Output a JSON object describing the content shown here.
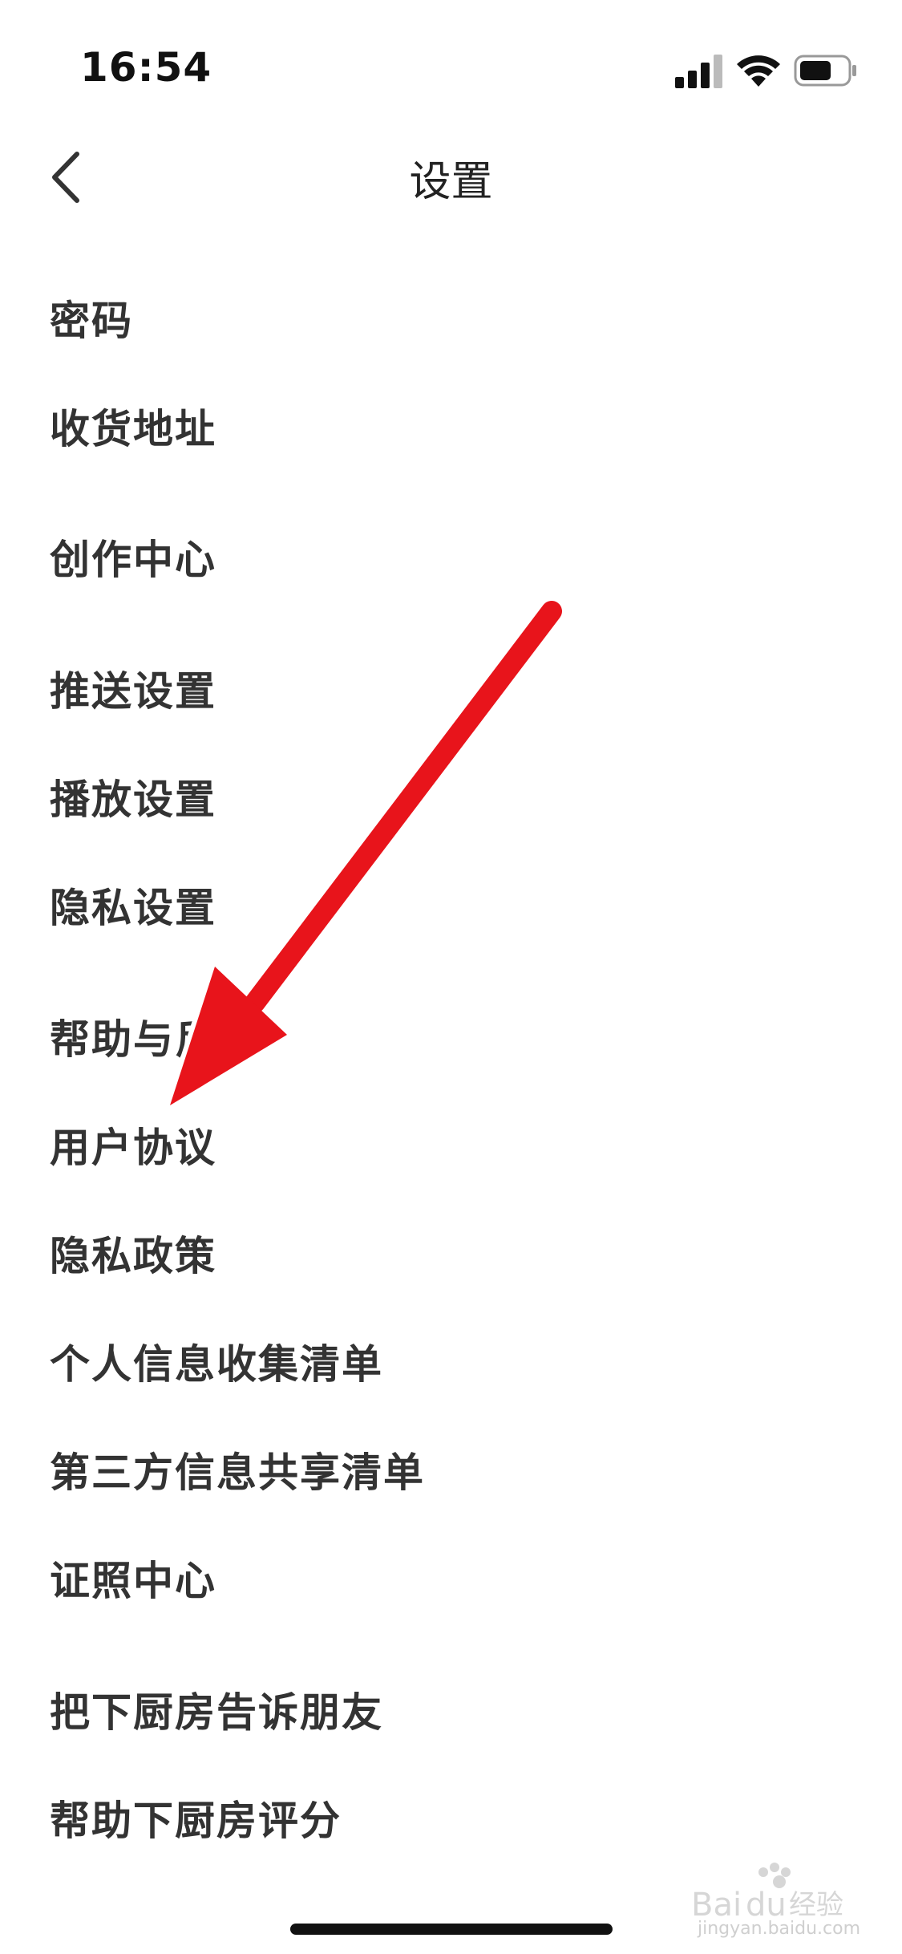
{
  "status_bar": {
    "time": "16:54",
    "icons": [
      "signal-icon",
      "wifi-icon",
      "battery-icon"
    ]
  },
  "nav": {
    "title": "设置",
    "back_icon": "chevron-left-icon"
  },
  "settings_items": [
    "密码",
    "收货地址",
    "创作中心",
    "推送设置",
    "播放设置",
    "隐私设置",
    "帮助与反馈",
    "用户协议",
    "隐私政策",
    "个人信息收集清单",
    "第三方信息共享清单",
    "证照中心",
    "把下厨房告诉朋友",
    "帮助下厨房评分"
  ],
  "annotation": {
    "arrow_color": "#e8141b",
    "arrow_outline": "#ffffff"
  },
  "watermark": {
    "logo": "Baidu经验",
    "url": "jingyan.baidu.com"
  },
  "colors": {
    "background": "#ffffff",
    "text": "#333333",
    "home_indicator": "#111111"
  }
}
